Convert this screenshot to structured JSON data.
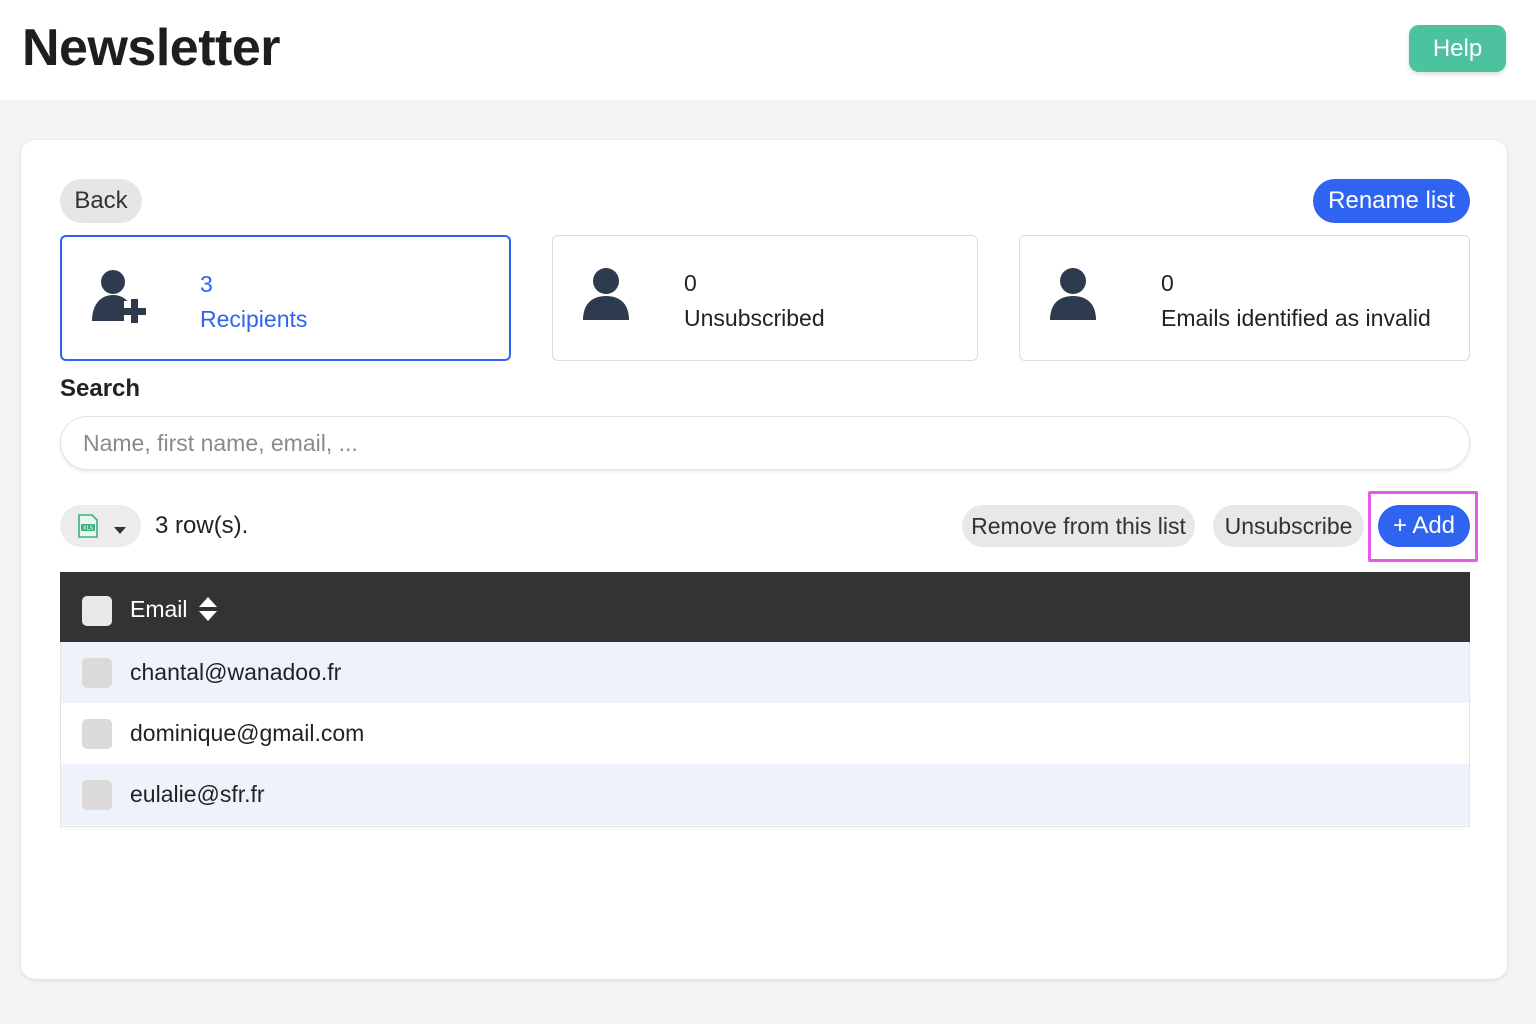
{
  "header": {
    "title": "Newsletter",
    "help_label": "Help"
  },
  "toolbar_top": {
    "back_label": "Back",
    "rename_label": "Rename list"
  },
  "stats": [
    {
      "count": "3",
      "label": "Recipients",
      "icon": "user-plus-icon",
      "active": true
    },
    {
      "count": "0",
      "label": "Unsubscribed",
      "icon": "user-icon",
      "active": false
    },
    {
      "count": "0",
      "label": "Emails identified as invalid",
      "icon": "user-icon",
      "active": false
    }
  ],
  "search": {
    "label": "Search",
    "placeholder": "Name, first name, email, ..."
  },
  "list_toolbar": {
    "export_icon": "excel-icon",
    "rows_text": "3 row(s).",
    "remove_label": "Remove from this list",
    "unsubscribe_label": "Unsubscribe",
    "add_label": "+ Add"
  },
  "table": {
    "columns": [
      "Email"
    ],
    "rows": [
      {
        "email": "chantal@wanadoo.fr"
      },
      {
        "email": "dominique@gmail.com"
      },
      {
        "email": "eulalie@sfr.fr"
      }
    ]
  },
  "colors": {
    "accent": "#2f64f0",
    "help": "#4cc29e",
    "highlight": "#e65be9",
    "table_header": "#333333"
  }
}
